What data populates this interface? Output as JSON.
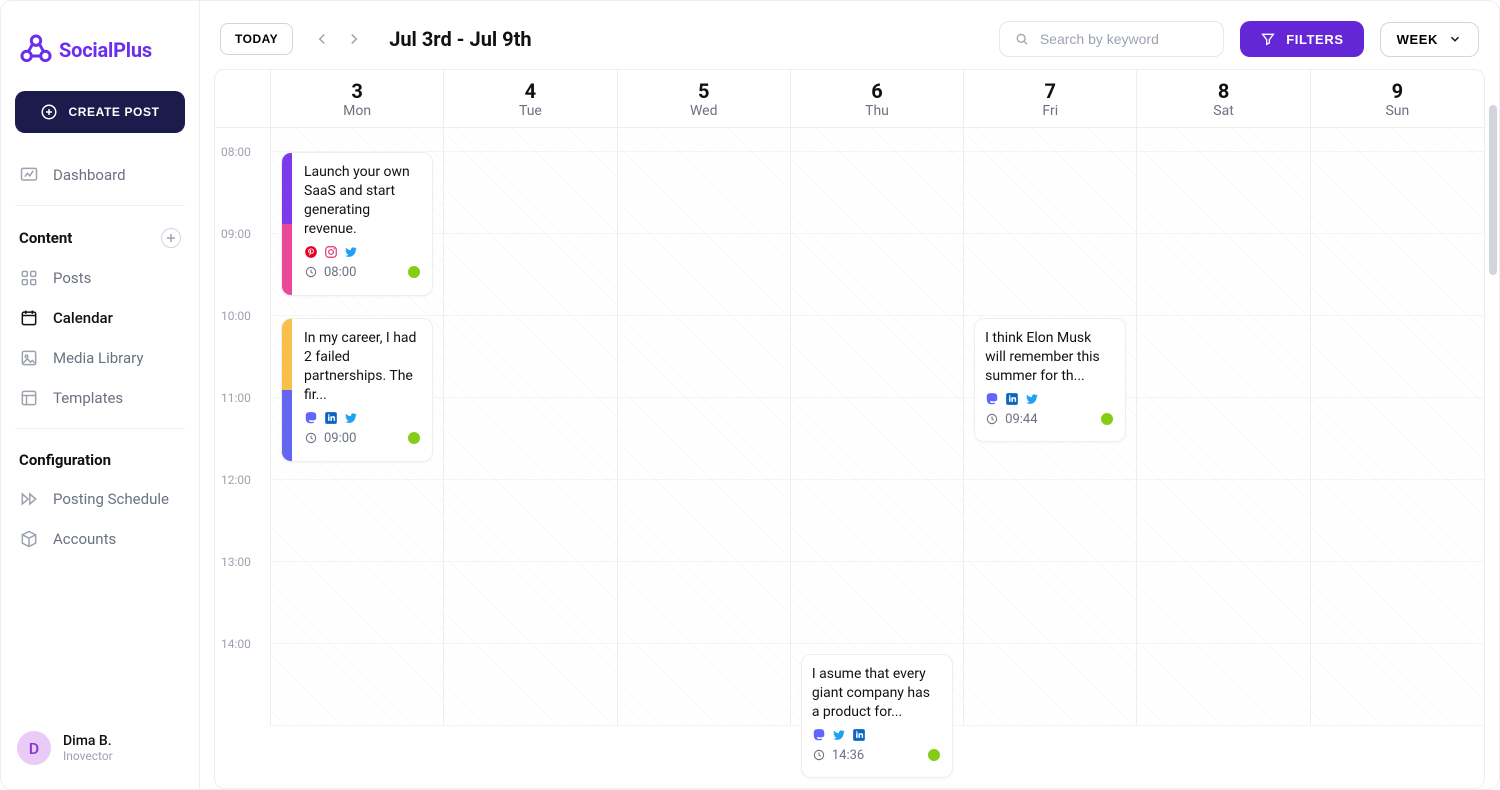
{
  "brand": {
    "name": "SocialPlus"
  },
  "sidebar": {
    "create_label": "CREATE POST",
    "dashboard": "Dashboard",
    "section_content": "Content",
    "posts": "Posts",
    "calendar": "Calendar",
    "media": "Media Library",
    "templates": "Templates",
    "section_config": "Configuration",
    "schedule": "Posting Schedule",
    "accounts": "Accounts"
  },
  "user": {
    "initial": "D",
    "name": "Dima B.",
    "org": "Inovector"
  },
  "toolbar": {
    "today": "TODAY",
    "range": "Jul 3rd - Jul 9th",
    "search_placeholder": "Search by keyword",
    "filters": "FILTERS",
    "view": "WEEK"
  },
  "days": [
    {
      "num": "3",
      "dow": "Mon"
    },
    {
      "num": "4",
      "dow": "Tue"
    },
    {
      "num": "5",
      "dow": "Wed"
    },
    {
      "num": "6",
      "dow": "Thu"
    },
    {
      "num": "7",
      "dow": "Fri"
    },
    {
      "num": "8",
      "dow": "Sat"
    },
    {
      "num": "9",
      "dow": "Sun"
    }
  ],
  "hours": [
    "08:00",
    "09:00",
    "10:00",
    "11:00",
    "12:00",
    "13:00",
    "14:00"
  ],
  "events": {
    "e1": {
      "text": "Launch your own SaaS and start generating revenue.",
      "time": "08:00"
    },
    "e2": {
      "text": "In my career, I had 2 failed partnerships. The fir...",
      "time": "09:00"
    },
    "e3": {
      "text": "I think Elon Musk will remember this summer for th...",
      "time": "09:44"
    },
    "e4": {
      "text": "I asume that every giant company has a product for...",
      "time": "14:36"
    }
  }
}
